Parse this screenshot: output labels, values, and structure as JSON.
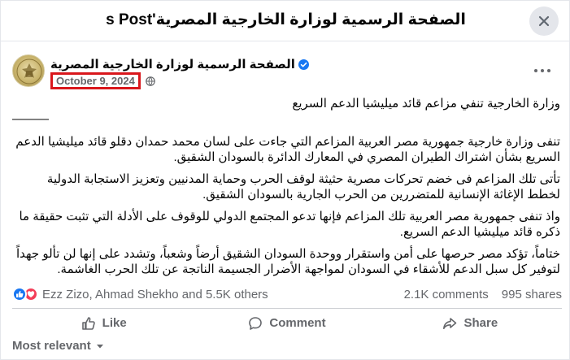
{
  "header": {
    "title": "الصفحة الرسمية لوزارة الخارجية المصرية's Post",
    "close_icon": "close-icon"
  },
  "post": {
    "page_name": "الصفحة الرسمية لوزارة الخارجية المصرية",
    "verified_icon": "verified-badge-icon",
    "date": "October 9, 2024",
    "audience_icon": "globe-icon",
    "title_line": "وزارة الخارجية تنفي مزاعم قائد ميليشيا الدعم السريع",
    "dash_line": "———",
    "paragraphs": [
      "تنفى وزارة خارجية جمهورية مصر العربية المزاعم التي جاءت على لسان محمد حمدان دقلو قائد ميليشيا الدعم السريع بشأن اشتراك الطيران المصري في المعارك الدائرة بالسودان الشقيق.",
      "تأتى تلك المزاعم فى خضم تحركات مصرية حثيثة لوقف الحرب وحماية المدنيين وتعزيز الاستجابة الدولية لخطط الإغاثة الإنسانية للمتضررين من الحرب الجارية بالسودان الشقيق.",
      "واذ تنفى جمهورية مصر العربية تلك المزاعم فإنها تدعو المجتمع الدولي للوقوف على الأدلة التي تثبت حقيقة ما ذكره قائد ميليشيا الدعم السريع.",
      "ختاماً، تؤكد مصر حرصها على أمن واستقرار ووحدة السودان الشقيق أرضاً وشعباً، وتشدد على إنها لن تألو جهداً لتوفير كل سبل الدعم للأشقاء في السودان لمواجهة الأضرار الجسيمة الناتجة عن تلك الحرب الغاشمة."
    ]
  },
  "stats": {
    "reacted_by": "Ezz Zizo, Ahmad Shekho and 5.5K others",
    "comments": "2.1K comments",
    "shares": "995 shares"
  },
  "actions": {
    "like": "Like",
    "comment": "Comment",
    "share": "Share"
  },
  "sort": {
    "label": "Most relevant"
  },
  "colors": {
    "accent": "#1877f2",
    "love": "#f33e58",
    "highlight_box": "#d9171c",
    "secondary_text": "#65676b"
  }
}
